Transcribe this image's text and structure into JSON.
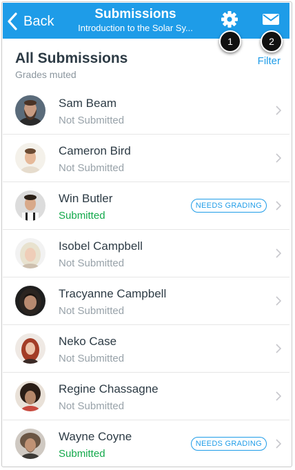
{
  "navbar": {
    "back_label": "Back",
    "title": "Submissions",
    "subtitle": "Introduction to the Solar Sy...",
    "background": "#1e9ce8",
    "icons": [
      "gear-icon",
      "mail-icon"
    ]
  },
  "callouts": [
    "1",
    "2"
  ],
  "header": {
    "title": "All Submissions",
    "subtitle": "Grades muted",
    "filter_label": "Filter"
  },
  "colors": {
    "accent": "#1e9ce8",
    "submitted": "#13a94b",
    "muted": "#98a2a9"
  },
  "submissions": [
    {
      "name": "Sam Beam",
      "status": "Not Submitted",
      "badge": ""
    },
    {
      "name": "Cameron Bird",
      "status": "Not Submitted",
      "badge": ""
    },
    {
      "name": "Win Butler",
      "status": "Submitted",
      "badge": "NEEDS GRADING"
    },
    {
      "name": "Isobel Campbell",
      "status": "Not Submitted",
      "badge": ""
    },
    {
      "name": "Tracyanne Campbell",
      "status": "Not Submitted",
      "badge": ""
    },
    {
      "name": "Neko Case",
      "status": "Not Submitted",
      "badge": ""
    },
    {
      "name": "Regine Chassagne",
      "status": "Not Submitted",
      "badge": ""
    },
    {
      "name": "Wayne Coyne",
      "status": "Submitted",
      "badge": "NEEDS GRADING"
    }
  ]
}
